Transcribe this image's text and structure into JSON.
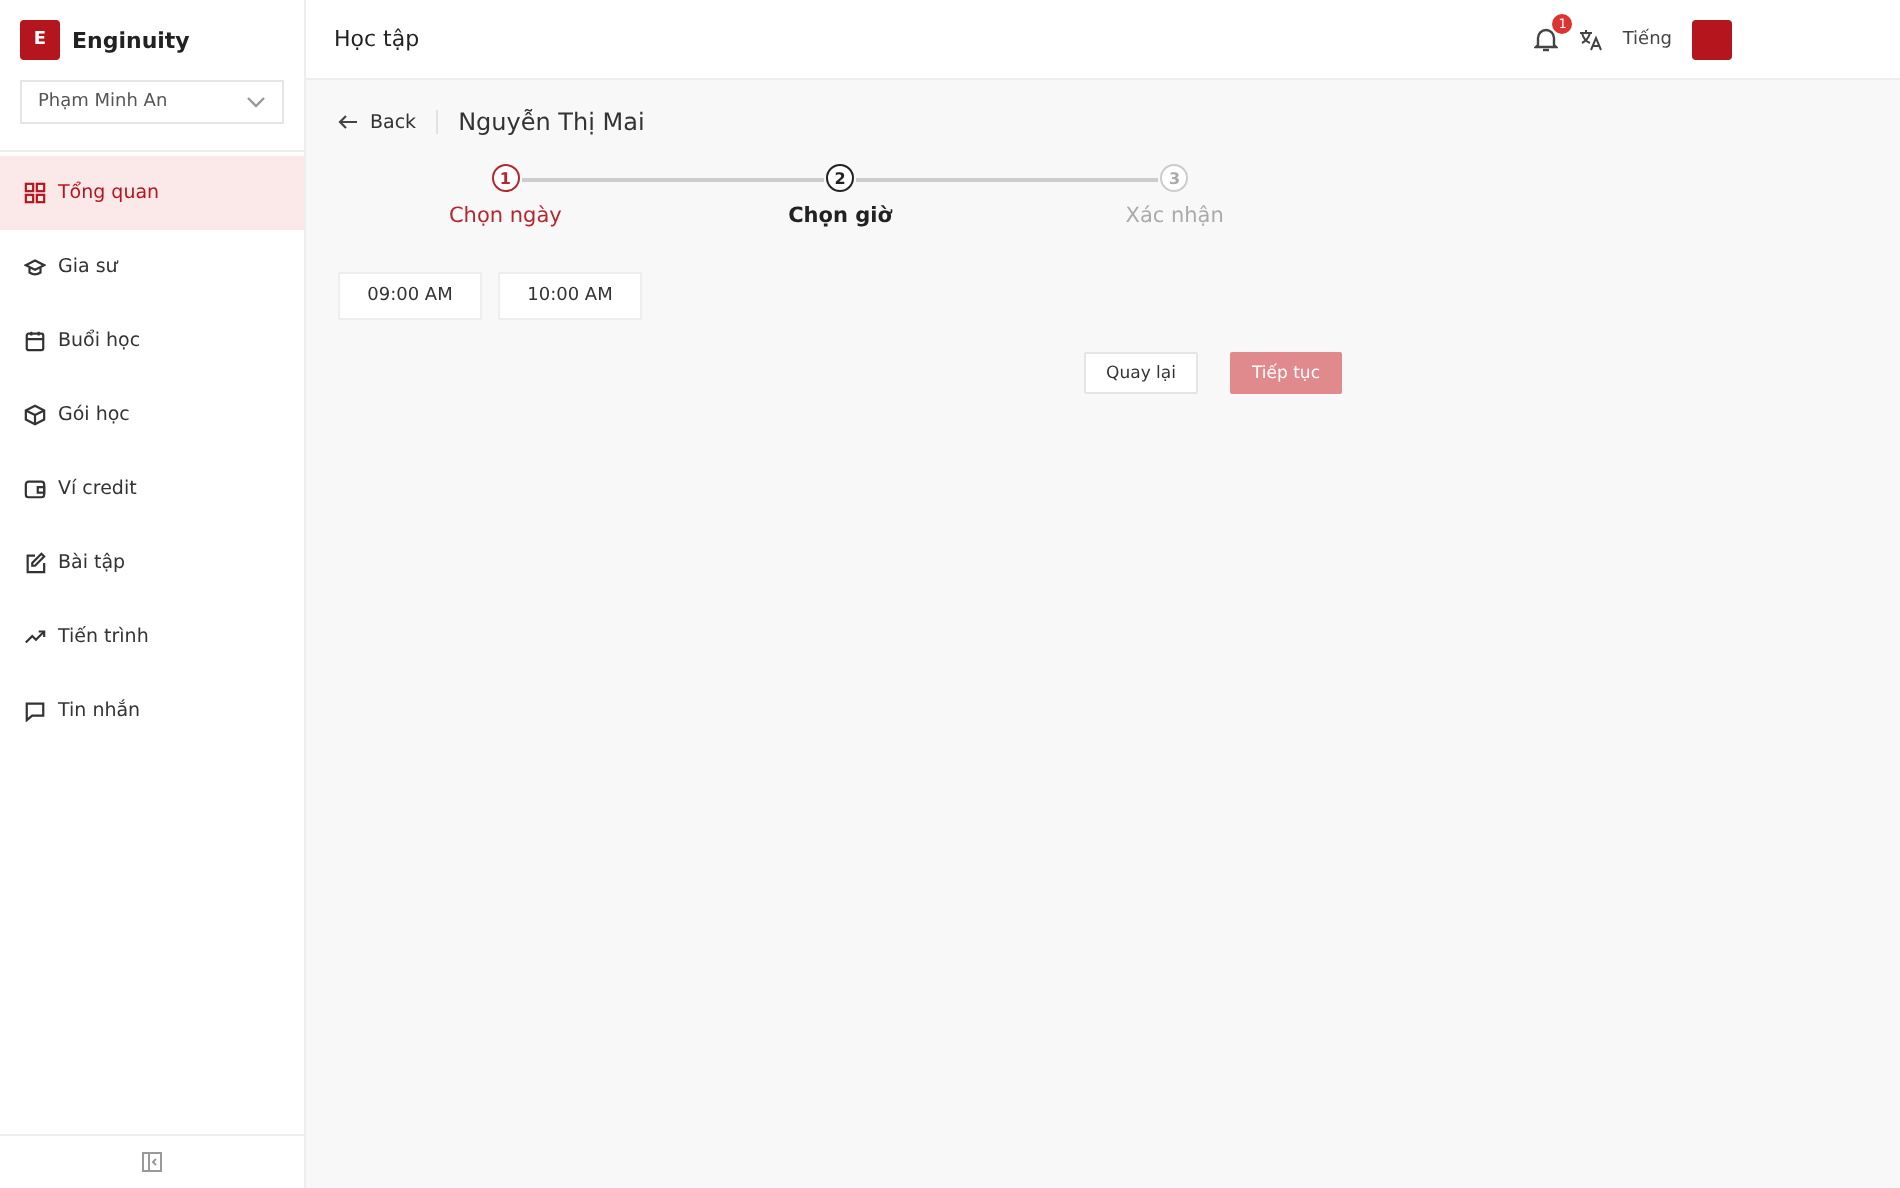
{
  "brand": {
    "logo_letter": "E",
    "name": "Enginuity"
  },
  "student_select": {
    "value": "Phạm Minh An"
  },
  "sidebar": {
    "items": [
      {
        "label": "Tổng quan",
        "selected": true
      },
      {
        "label": "Gia sư",
        "selected": false
      },
      {
        "label": "Buổi học",
        "selected": false
      },
      {
        "label": "Gói học",
        "selected": false
      },
      {
        "label": "Ví credit",
        "selected": false
      },
      {
        "label": "Bài tập",
        "selected": false
      },
      {
        "label": "Tiến trình",
        "selected": false
      },
      {
        "label": "Tin nhắn",
        "selected": false
      }
    ]
  },
  "header": {
    "title": "Học tập",
    "notification_count": "1",
    "language": "Tiếng"
  },
  "page": {
    "back": "Back",
    "tutor_name": "Nguyễn Thị Mai"
  },
  "steps": [
    {
      "number": "1",
      "label": "Chọn ngày",
      "completed": true,
      "selected": false
    },
    {
      "number": "2",
      "label": "Chọn giờ",
      "completed": false,
      "selected": true
    },
    {
      "number": "3",
      "label": "Xác nhận",
      "completed": false,
      "selected": false
    }
  ],
  "time_slots": [
    {
      "label": "09:00 AM",
      "selected": false
    },
    {
      "label": "10:00 AM",
      "selected": false
    }
  ],
  "actions": {
    "back": {
      "label": "Quay lại",
      "disabled": false
    },
    "next": {
      "label": "Tiếp tục",
      "disabled": true
    }
  }
}
